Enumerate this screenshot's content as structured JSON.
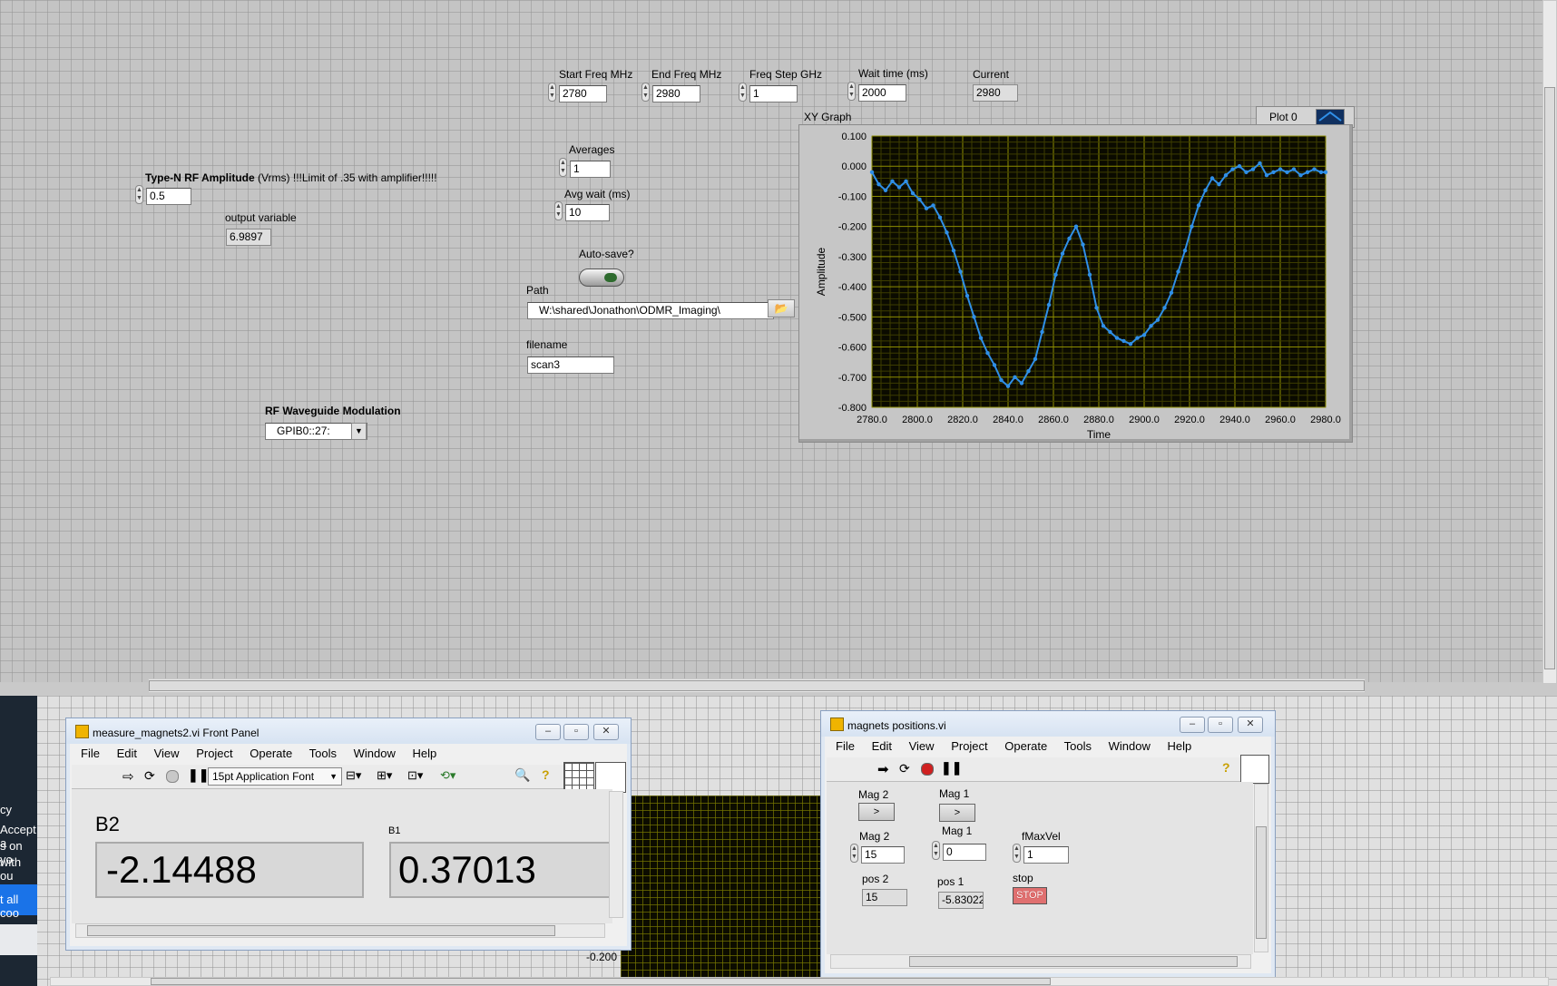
{
  "main_panel": {
    "start_freq": {
      "label": "Start Freq MHz",
      "value": "2780"
    },
    "end_freq": {
      "label": "End Freq MHz",
      "value": "2980"
    },
    "freq_step": {
      "label": "Freq Step GHz",
      "value": "1"
    },
    "wait_time": {
      "label": "Wait time (ms)",
      "value": "2000"
    },
    "current": {
      "label": "Current",
      "value": "2980"
    },
    "averages": {
      "label": "Averages",
      "value": "1"
    },
    "avg_wait": {
      "label": "Avg wait (ms)",
      "value": "10"
    },
    "auto_save": {
      "label": "Auto-save?"
    },
    "path": {
      "label": "Path",
      "value": "W:\\shared\\Jonathon\\ODMR_Imaging\\"
    },
    "filename": {
      "label": "filename",
      "value": "scan3"
    },
    "rf_amplitude": {
      "label_bold": "Type-N RF Amplitude",
      "label_rest": " (Vrms) !!!Limit of .35 with amplifier!!!!!",
      "value": "0.5"
    },
    "output_variable": {
      "label": "output variable",
      "value": "6.9897"
    },
    "rf_waveguide": {
      "label": "RF Waveguide Modulation",
      "value": "GPIB0::27:"
    }
  },
  "xy_graph": {
    "label": "XY Graph",
    "legend": "Plot 0",
    "ylabel": "Amplitude",
    "xlabel": "Time",
    "yticks": [
      "0.100",
      "0.000",
      "-0.100",
      "-0.200",
      "-0.300",
      "-0.400",
      "-0.500",
      "-0.600",
      "-0.700",
      "-0.800"
    ],
    "xticks": [
      "2780.0",
      "2800.0",
      "2820.0",
      "2840.0",
      "2860.0",
      "2880.0",
      "2900.0",
      "2920.0",
      "2940.0",
      "2960.0",
      "2980.0"
    ]
  },
  "chart_data": {
    "type": "scatter",
    "title": "XY Graph",
    "xlabel": "Time",
    "ylabel": "Amplitude",
    "xlim": [
      2780,
      2980
    ],
    "ylim": [
      -0.8,
      0.1
    ],
    "grid": true,
    "legend": "top-right",
    "series": [
      {
        "name": "Plot 0",
        "color": "#2f8fe8",
        "x": [
          2780,
          2783,
          2786,
          2789,
          2792,
          2795,
          2798,
          2801,
          2804,
          2807,
          2810,
          2813,
          2816,
          2819,
          2822,
          2825,
          2828,
          2831,
          2834,
          2837,
          2840,
          2843,
          2846,
          2849,
          2852,
          2855,
          2858,
          2861,
          2864,
          2867,
          2870,
          2873,
          2876,
          2879,
          2882,
          2885,
          2888,
          2891,
          2894,
          2897,
          2900,
          2903,
          2906,
          2909,
          2912,
          2915,
          2918,
          2921,
          2924,
          2927,
          2930,
          2933,
          2936,
          2939,
          2942,
          2945,
          2948,
          2951,
          2954,
          2957,
          2960,
          2963,
          2966,
          2969,
          2972,
          2975,
          2978,
          2980
        ],
        "y": [
          -0.02,
          -0.06,
          -0.08,
          -0.05,
          -0.07,
          -0.05,
          -0.09,
          -0.11,
          -0.14,
          -0.13,
          -0.17,
          -0.22,
          -0.28,
          -0.35,
          -0.43,
          -0.5,
          -0.57,
          -0.62,
          -0.66,
          -0.71,
          -0.73,
          -0.7,
          -0.72,
          -0.68,
          -0.64,
          -0.55,
          -0.46,
          -0.36,
          -0.29,
          -0.24,
          -0.2,
          -0.26,
          -0.36,
          -0.47,
          -0.53,
          -0.55,
          -0.57,
          -0.58,
          -0.59,
          -0.57,
          -0.56,
          -0.53,
          -0.51,
          -0.47,
          -0.42,
          -0.35,
          -0.28,
          -0.2,
          -0.13,
          -0.08,
          -0.04,
          -0.06,
          -0.03,
          -0.01,
          0.0,
          -0.02,
          -0.01,
          0.01,
          -0.03,
          -0.02,
          -0.01,
          -0.02,
          -0.01,
          -0.03,
          -0.02,
          -0.01,
          -0.02,
          -0.02
        ]
      }
    ]
  },
  "win_measure": {
    "title": "measure_magnets2.vi Front Panel",
    "menu": [
      "File",
      "Edit",
      "View",
      "Project",
      "Operate",
      "Tools",
      "Window",
      "Help"
    ],
    "font": "15pt Application Font",
    "b2_label": "B2",
    "b2_value": "-2.14488",
    "b1_label": "B1",
    "b1_value": "0.37013"
  },
  "win_positions": {
    "title": "magnets positions.vi",
    "menu": [
      "File",
      "Edit",
      "View",
      "Project",
      "Operate",
      "Tools",
      "Window",
      "Help"
    ],
    "mag2_btn_label": "Mag 2",
    "mag1_btn_label": "Mag 1",
    "btn_text": ">",
    "mag2_label": "Mag 2",
    "mag2_value": "15",
    "mag1_label": "Mag 1",
    "mag1_value": "0",
    "fmaxvel_label": "fMaxVel",
    "fmaxvel_value": "1",
    "pos2_label": "pos 2",
    "pos2_value": "15",
    "pos1_label": "pos 1",
    "pos1_value": "-5.83022",
    "stop_label": "stop",
    "stop_button": "STOP"
  },
  "background": {
    "left_text": [
      "cy",
      "Accept a",
      "s on yo",
      "with ou",
      "t all coo"
    ],
    "partial_tick": "-0.200"
  }
}
